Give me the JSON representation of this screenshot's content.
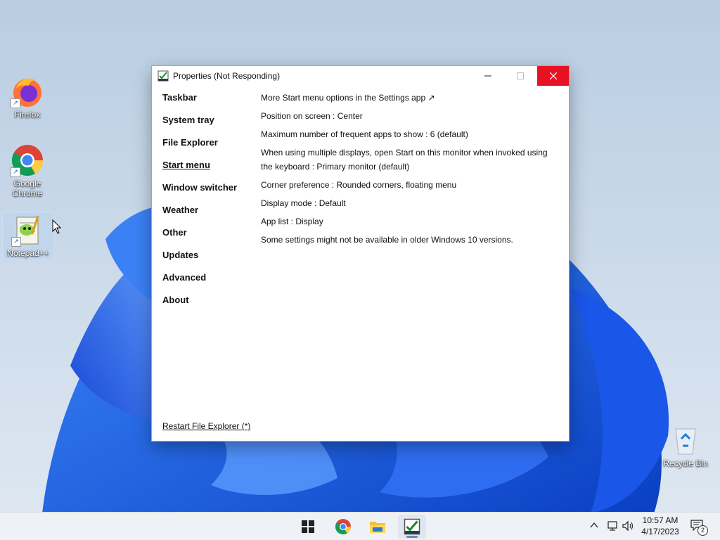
{
  "desktop": {
    "icons": [
      {
        "label": "Firefox",
        "icon": "firefox-icon"
      },
      {
        "label": "Google Chrome",
        "icon": "chrome-icon"
      },
      {
        "label": "Notepad++",
        "icon": "notepadpp-icon"
      },
      {
        "label": "Recycle Bin",
        "icon": "recycle-bin-icon"
      }
    ]
  },
  "window": {
    "title": "Properties (Not Responding)",
    "nav": [
      {
        "label": "Taskbar"
      },
      {
        "label": "System tray"
      },
      {
        "label": "File Explorer"
      },
      {
        "label": "Start menu",
        "active": true
      },
      {
        "label": "Window switcher"
      },
      {
        "label": "Weather"
      },
      {
        "label": "Other"
      },
      {
        "label": "Updates"
      },
      {
        "label": "Advanced"
      },
      {
        "label": "About"
      }
    ],
    "restart_link": "Restart File Explorer (*)",
    "settings": [
      "More Start menu options in the Settings app ↗",
      "Position on screen : Center",
      "Maximum number of frequent apps to show : 6 (default)",
      "When using multiple displays, open Start on this monitor when invoked using the keyboard : Primary monitor (default)",
      "Corner preference : Rounded corners, floating menu",
      "Display mode : Default",
      "App list : Display",
      "Some settings might not be available in older Windows 10 versions."
    ]
  },
  "taskbar": {
    "apps": [
      "start-icon",
      "chrome-icon",
      "file-explorer-icon",
      "properties-app-icon"
    ],
    "clock": {
      "time": "10:57 AM",
      "date": "4/17/2023"
    },
    "notification_count": "2"
  },
  "colors": {
    "close_red": "#e81123",
    "wallpaper_blue": "#1f5fe0",
    "wallpaper_bg": "#c9d7e6"
  }
}
